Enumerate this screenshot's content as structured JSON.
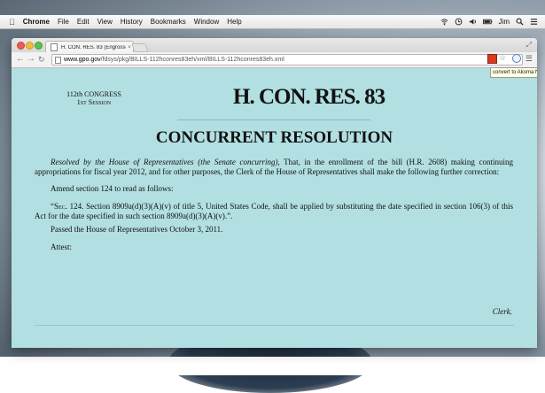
{
  "menubar": {
    "app_name": "Chrome",
    "items": [
      "File",
      "Edit",
      "View",
      "History",
      "Bookmarks",
      "Window",
      "Help"
    ],
    "user": "Jim"
  },
  "browser": {
    "tab_title": "H. CON. RES. 83 (Engrosse",
    "url_host": "www.gpo.gov",
    "url_path": "/fdsys/pkg/BILLS-112hconres83eh/xml/BILLS-112hconres83eh.xml",
    "tooltip": "convert to Akoma Ntoso",
    "icons": [
      "back-icon",
      "forward-icon",
      "reload-icon",
      "page-icon",
      "akoma-extension-icon",
      "star-icon",
      "clock-extension-icon",
      "menu-icon"
    ]
  },
  "document": {
    "congress": "112th CONGRESS",
    "session": "1st Session",
    "bill_number": "H. CON. RES. 83",
    "title": "CONCURRENT RESOLUTION",
    "resolved_italic": "Resolved by the House of Representatives (the Senate concurring),",
    "resolved_text": " That, in the enrollment of the bill (H.R. 2608) making continuing appropriations for fiscal year 2012, and for other purposes, the Clerk of the House of Representatives shall make the following further correction:",
    "amend": "Amend section 124 to read as follows:",
    "section_prefix": "“Sec. 124.",
    "section_text": " Section 8909a(d)(3)(A)(v) of title 5, United States Code, shall be applied by substituting the date specified in section 106(3) of this Act for the date specified in such section 8909a(d)(3)(A)(v).”.",
    "passed": "Passed the House of Representatives October 3, 2011.",
    "attest": "Attest:",
    "clerk": "Clerk."
  }
}
